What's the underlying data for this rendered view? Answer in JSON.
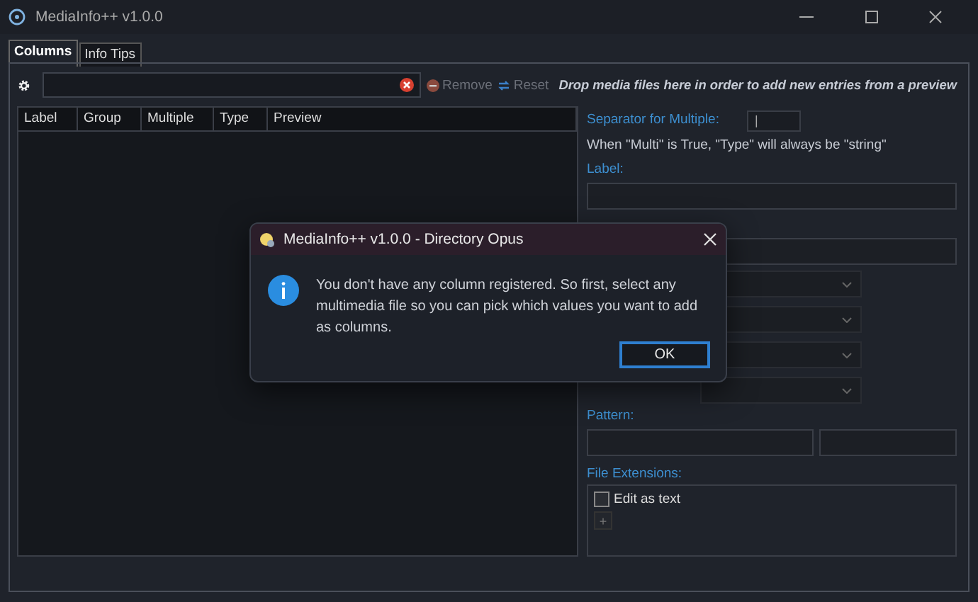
{
  "window": {
    "title": "MediaInfo++ v1.0.0"
  },
  "tabs": [
    {
      "label": "Columns",
      "selected": true
    },
    {
      "label": "Info Tips",
      "selected": false
    }
  ],
  "toolbar": {
    "remove": {
      "label": "Remove",
      "disabled": true
    },
    "reset": {
      "label": "Reset",
      "disabled": true
    },
    "hint": "Drop media files here in order to add new entries from a preview"
  },
  "table": {
    "columns": [
      "Label",
      "Group",
      "Multiple",
      "Type",
      "Preview"
    ]
  },
  "editor": {
    "separator_label": "Separator for Multiple:",
    "separator_value": "|",
    "note": "When \"Multi\" is True, \"Type\" will always be \"string\"",
    "label_label": "Label:",
    "pattern_label": "Pattern:",
    "extensions_label": "File Extensions:",
    "edit_as_text": {
      "label": "Edit as text",
      "checked": false
    },
    "add_button": "+"
  },
  "dialog": {
    "title": "MediaInfo++ v1.0.0 - Directory Opus",
    "message": "You don't have any column registered. So first, select any multimedia file so you can pick which values you want to add as columns.",
    "ok": "OK"
  }
}
